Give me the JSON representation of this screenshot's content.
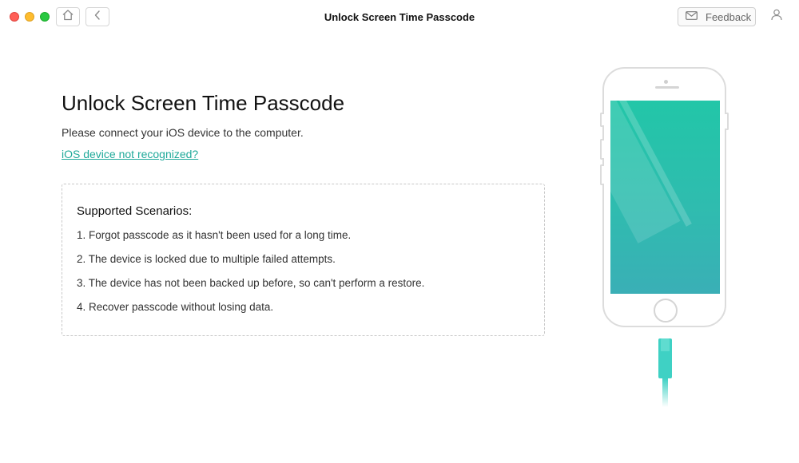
{
  "window": {
    "title": "Unlock Screen Time Passcode"
  },
  "toolbar": {
    "home_icon": "home-icon",
    "back_icon": "chevron-left-icon",
    "feedback_label": "Feedback",
    "feedback_icon": "envelope-icon",
    "user_icon": "user-icon"
  },
  "main": {
    "title": "Unlock Screen Time Passcode",
    "subtitle": "Please connect your iOS device to the computer.",
    "help_link": "iOS device not recognized?",
    "scenarios": {
      "heading": "Supported Scenarios:",
      "items": [
        "1. Forgot passcode as it hasn't been used for a long time.",
        "2. The device is locked due to multiple failed attempts.",
        "3. The device has not been backed up before, so can't perform a restore.",
        "4. Recover passcode without losing data."
      ]
    }
  },
  "colors": {
    "accent": "#1fa99a",
    "screen_top": "#22c6a8",
    "screen_bottom": "#3aafb6",
    "cable": "#3fd1c4"
  }
}
